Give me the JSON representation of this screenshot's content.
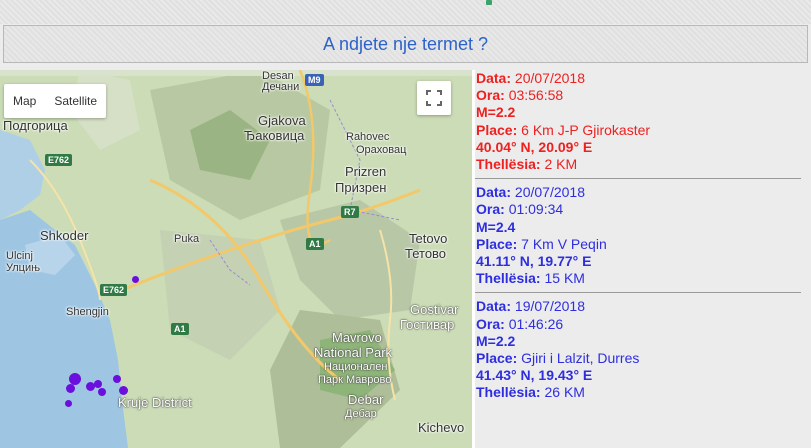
{
  "page": {
    "title": "A ndjete nje termet ?"
  },
  "map": {
    "controls": {
      "map_label": "Map",
      "satellite_label": "Satellite"
    },
    "place_labels": {
      "desan": "Desan",
      "dechani": "Дечани",
      "gjakova": "Gjakova",
      "djakovica": "Ђаковица",
      "rahovec": "Rahovec",
      "orahovac": "Ораховац",
      "prizren": "Prizren",
      "prizren_cyr": "Призрен",
      "podgorica": "Подгорица",
      "shkoder": "Shkoder",
      "puka": "Puka",
      "ulcinj": "Ulcinj",
      "ulcinj_cyr": "Улцињ",
      "shengjin": "Shengjin",
      "tetovo": "Tetovo",
      "tetovo_cyr": "Тетово",
      "gostivar": "Gostivar",
      "gostivar_cyr": "Гостивар",
      "mavrovo": "Mavrovo",
      "national_park": "National Park",
      "nac_park": "Национален",
      "park_mavrovo": "Парк Маврово",
      "kruje": "Kruje District",
      "debar": "Debar",
      "debar_cyr": "Дебар",
      "kichevo": "Kichevo"
    },
    "road_badges": {
      "m9": "M9",
      "e762a": "E762",
      "e762b": "E762",
      "r7": "R7",
      "a1a": "A1",
      "a1b": "A1"
    },
    "marker_color": "#6a0fdc"
  },
  "quakes": [
    {
      "color": "red",
      "data_key": "Data:",
      "data": "20/07/2018",
      "ora_key": "Ora:",
      "ora": "03:56:58",
      "magnitude": "M=2.2",
      "place_key": "Place:",
      "place": "6 Km J-P Gjirokaster",
      "coords": "40.04° N, 20.09° E",
      "depth_key": "Thellësia:",
      "depth": "2 KM"
    },
    {
      "color": "blue",
      "data_key": "Data:",
      "data": "20/07/2018",
      "ora_key": "Ora:",
      "ora": "01:09:34",
      "magnitude": "M=2.4",
      "place_key": "Place:",
      "place": "7 Km V Peqin",
      "coords": "41.11° N, 19.77° E",
      "depth_key": "Thellësia:",
      "depth": "15 KM"
    },
    {
      "color": "blue",
      "data_key": "Data:",
      "data": "19/07/2018",
      "ora_key": "Ora:",
      "ora": "01:46:26",
      "magnitude": "M=2.2",
      "place_key": "Place:",
      "place": "Gjiri i Lalzit, Durres",
      "coords": "41.43° N, 19.43° E",
      "depth_key": "Thellësia:",
      "depth": "26 KM"
    }
  ]
}
